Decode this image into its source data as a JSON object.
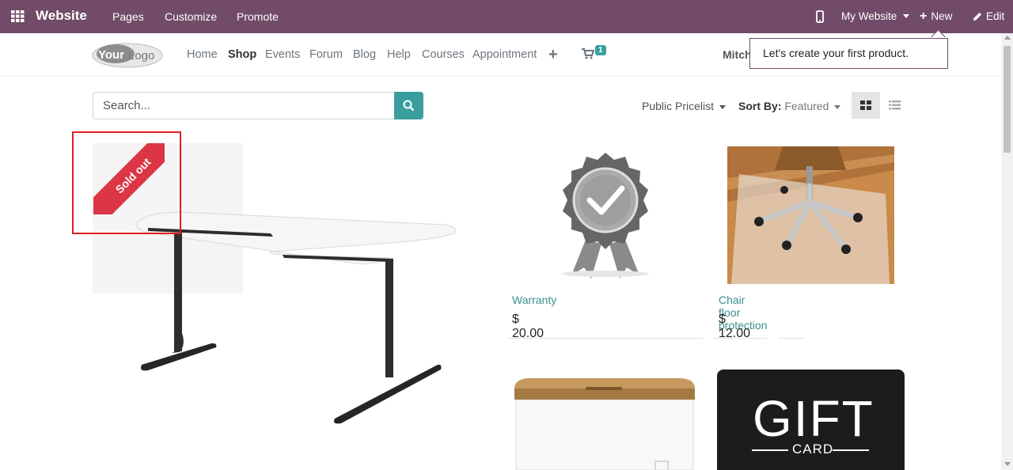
{
  "topbar": {
    "brand": "Website",
    "menu": [
      "Pages",
      "Customize",
      "Promote"
    ],
    "site_selector": "My Website",
    "new_label": "New",
    "edit_label": "Edit"
  },
  "header": {
    "logo_text": "YourLogo",
    "nav": [
      "Home",
      "Shop",
      "Events",
      "Forum",
      "Blog",
      "Help",
      "Courses",
      "Appointment"
    ],
    "active_nav": "Shop",
    "cart_count": "1",
    "user_name": "Mitch"
  },
  "tooltip": {
    "text": "Let's create your first product."
  },
  "shop": {
    "search_placeholder": "Search...",
    "pricelist": "Public Pricelist",
    "sort_label": "Sort By:",
    "sort_value": "Featured"
  },
  "products": [
    {
      "name": "",
      "price": "",
      "ribbon": "Sold out"
    },
    {
      "name": "Warranty",
      "price": "$ 20.00"
    },
    {
      "name": "Chair floor protection",
      "price": "$ 12.00"
    },
    {
      "name": "",
      "price": ""
    },
    {
      "name": "",
      "price": "",
      "image_text_main": "GIFT",
      "image_text_sub": "CARD"
    }
  ],
  "colors": {
    "topbar": "#714b67",
    "accent": "#3a9e9e",
    "ribbon": "#dc3545",
    "highlight": "#e02020"
  }
}
